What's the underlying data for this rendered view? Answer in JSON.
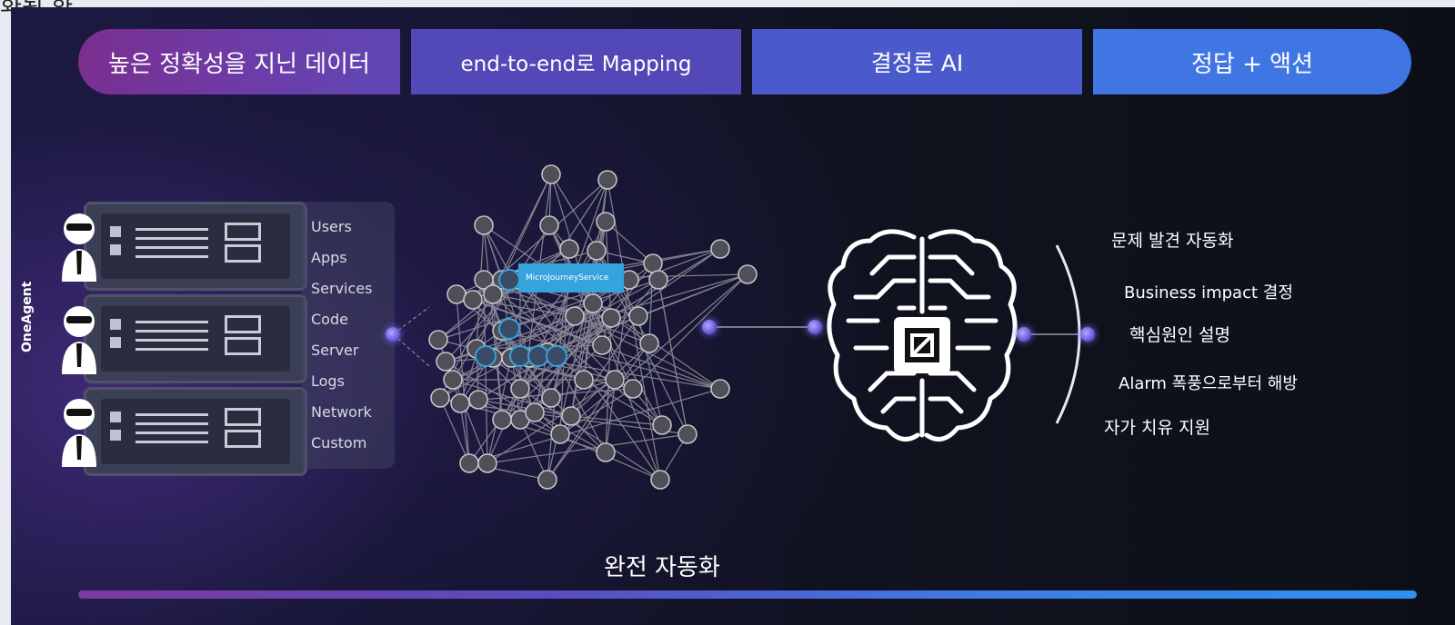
{
  "top_cut_text": "화된 화",
  "stages": [
    {
      "label": "높은 정확성을 지닌 데이터"
    },
    {
      "label": "end-to-end로 Mapping"
    },
    {
      "label": "결정론 AI"
    },
    {
      "label": "정답 + 액션"
    }
  ],
  "side_label": "OneAgent",
  "categories": [
    "Users",
    "Apps",
    "Services",
    "Code",
    "Server",
    "Logs",
    "Network",
    "Custom"
  ],
  "graph": {
    "highlight_label": "MicroJourneyService"
  },
  "outcomes": [
    "문제 발견 자동화",
    "Business impact 결정",
    "핵심원인 설명",
    "Alarm 폭풍으로부터 해방",
    "자가 치유 지원"
  ],
  "footer": {
    "label": "완전 자동화"
  },
  "colors": {
    "accent_purple": "#7a2f8f",
    "accent_blue": "#3f76e4",
    "connector": "#6b5cff",
    "graph_node": "#5f6068"
  },
  "icons": [
    "person-icon",
    "server-icon",
    "brain-chip-icon",
    "bracket-icon"
  ]
}
